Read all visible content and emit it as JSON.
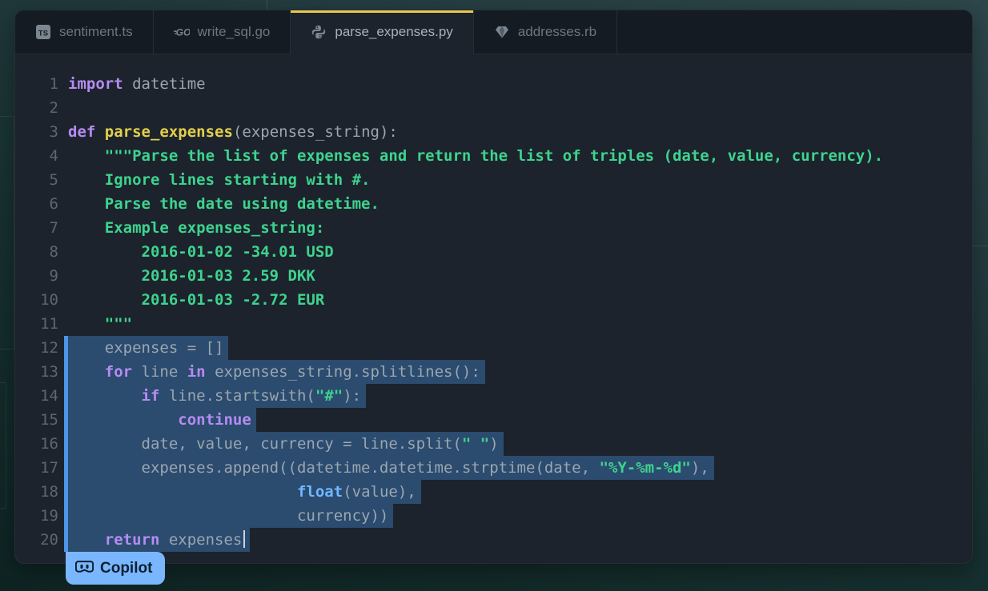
{
  "theme": {
    "editor-bg": "#1c232c",
    "tabbar-bg": "#151b22",
    "border": "#262d36",
    "accent-yellow": "#e8c84a",
    "gutter": "#5d6770",
    "code-default": "#9ba6b0",
    "kw": "#b58cf2",
    "fn": "#e3cf4b",
    "str": "#3ed38e",
    "bi": "#70b7ff",
    "sel-bg": "#2b4b6f",
    "sel-bar": "#4e94e8",
    "caret": "#ccd4dc",
    "badge-bg": "#7ab6fd",
    "badge-fg": "#0b2033",
    "tab-active-fg": "#a6b1bb",
    "tab-inactive-fg": "#6b7681",
    "icon-gray": "#7c8690"
  },
  "editor": {
    "tabs": [
      {
        "label": "sentiment.ts",
        "icon": "typescript",
        "active": false
      },
      {
        "label": "write_sql.go",
        "icon": "go",
        "active": false
      },
      {
        "label": "parse_expenses.py",
        "icon": "python",
        "active": true
      },
      {
        "label": "addresses.rb",
        "icon": "ruby",
        "active": false
      }
    ],
    "code": {
      "lines": [
        {
          "n": 1,
          "selected": false,
          "tokens": [
            [
              "kw",
              "import"
            ],
            [
              "pl",
              " datetime"
            ]
          ]
        },
        {
          "n": 2,
          "selected": false,
          "tokens": []
        },
        {
          "n": 3,
          "selected": false,
          "tokens": [
            [
              "kw",
              "def"
            ],
            [
              "pl",
              " "
            ],
            [
              "fn",
              "parse_expenses"
            ],
            [
              "pl",
              "(expenses_string):"
            ]
          ]
        },
        {
          "n": 4,
          "selected": false,
          "tokens": [
            [
              "pl",
              "    "
            ],
            [
              "str",
              "\"\"\"Parse the list of expenses and return the list of triples (date, value, currency)."
            ]
          ]
        },
        {
          "n": 5,
          "selected": false,
          "tokens": [
            [
              "pl",
              "    "
            ],
            [
              "str",
              "Ignore lines starting with #."
            ]
          ]
        },
        {
          "n": 6,
          "selected": false,
          "tokens": [
            [
              "pl",
              "    "
            ],
            [
              "str",
              "Parse the date using datetime."
            ]
          ]
        },
        {
          "n": 7,
          "selected": false,
          "tokens": [
            [
              "pl",
              "    "
            ],
            [
              "str",
              "Example expenses_string:"
            ]
          ]
        },
        {
          "n": 8,
          "selected": false,
          "tokens": [
            [
              "pl",
              "        "
            ],
            [
              "str",
              "2016-01-02 -34.01 USD"
            ]
          ]
        },
        {
          "n": 9,
          "selected": false,
          "tokens": [
            [
              "pl",
              "        "
            ],
            [
              "str",
              "2016-01-03 2.59 DKK"
            ]
          ]
        },
        {
          "n": 10,
          "selected": false,
          "tokens": [
            [
              "pl",
              "        "
            ],
            [
              "str",
              "2016-01-03 -2.72 EUR"
            ]
          ]
        },
        {
          "n": 11,
          "selected": false,
          "tokens": [
            [
              "pl",
              "    "
            ],
            [
              "str",
              "\"\"\""
            ]
          ]
        },
        {
          "n": 12,
          "selected": true,
          "tokens": [
            [
              "pl",
              "    expenses = []"
            ]
          ]
        },
        {
          "n": 13,
          "selected": true,
          "tokens": [
            [
              "pl",
              "    "
            ],
            [
              "kw",
              "for"
            ],
            [
              "pl",
              " line "
            ],
            [
              "kw",
              "in"
            ],
            [
              "pl",
              " expenses_string.splitlines():"
            ]
          ]
        },
        {
          "n": 14,
          "selected": true,
          "tokens": [
            [
              "pl",
              "        "
            ],
            [
              "kw",
              "if"
            ],
            [
              "pl",
              " line.startswith("
            ],
            [
              "str",
              "\"#\""
            ],
            [
              "pl",
              "):"
            ]
          ]
        },
        {
          "n": 15,
          "selected": true,
          "tokens": [
            [
              "pl",
              "            "
            ],
            [
              "kw",
              "continue"
            ]
          ]
        },
        {
          "n": 16,
          "selected": true,
          "tokens": [
            [
              "pl",
              "        date, value, currency = line.split("
            ],
            [
              "str",
              "\" \""
            ],
            [
              "pl",
              ")"
            ]
          ]
        },
        {
          "n": 17,
          "selected": true,
          "tokens": [
            [
              "pl",
              "        expenses.append((datetime.datetime.strptime(date, "
            ],
            [
              "str",
              "\"%Y-%m-%d\""
            ],
            [
              "pl",
              "),"
            ]
          ]
        },
        {
          "n": 18,
          "selected": true,
          "tokens": [
            [
              "pl",
              "                         "
            ],
            [
              "bi",
              "float"
            ],
            [
              "pl",
              "(value),"
            ]
          ]
        },
        {
          "n": 19,
          "selected": true,
          "tokens": [
            [
              "pl",
              "                         currency))"
            ]
          ]
        },
        {
          "n": 20,
          "selected": true,
          "cursor": true,
          "tokens": [
            [
              "pl",
              "    "
            ],
            [
              "kw",
              "return"
            ],
            [
              "pl",
              " expenses"
            ]
          ]
        }
      ]
    }
  },
  "badge": {
    "label": "Copilot"
  }
}
